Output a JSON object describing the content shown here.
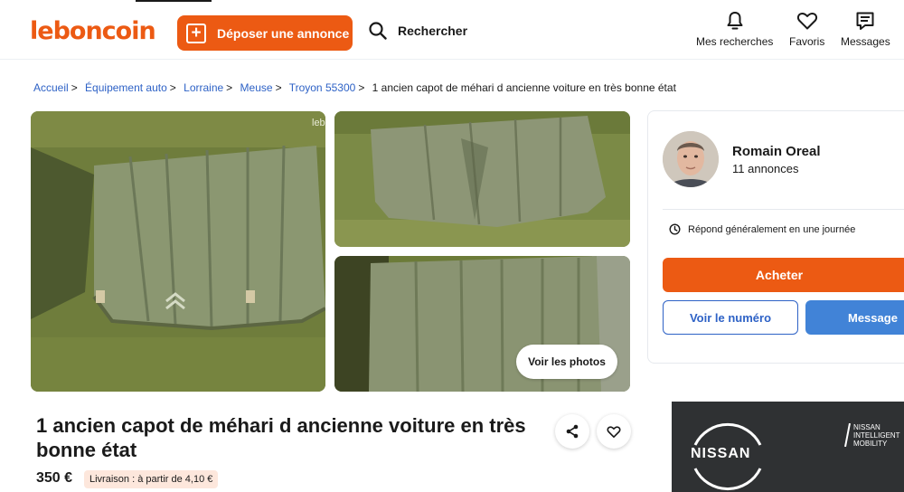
{
  "header": {
    "logo": "leboncoin",
    "post_ad_label": "Déposer une annonce",
    "search_label": "Rechercher",
    "nav": [
      {
        "label": "Mes recherches",
        "icon": "bell-icon"
      },
      {
        "label": "Favoris",
        "icon": "heart-icon"
      },
      {
        "label": "Messages",
        "icon": "message-icon"
      }
    ]
  },
  "breadcrumb": [
    {
      "label": "Accueil",
      "link": false
    },
    {
      "label": "Équipement auto",
      "link": true
    },
    {
      "label": "Lorraine",
      "link": true
    },
    {
      "label": "Meuse",
      "link": true
    },
    {
      "label": "Troyon 55300",
      "link": true
    },
    {
      "label": "1 ancien capot de méhari d ancienne voiture en très bonne état",
      "link": false
    }
  ],
  "gallery": {
    "view_photos_label": "Voir les photos",
    "watermark": "leb"
  },
  "listing": {
    "title": "1 ancien capot de méhari d ancienne voiture en très bonne état",
    "price": "350 €",
    "delivery": "Livraison : à partir de 4,10 €"
  },
  "seller": {
    "name": "Romain Oreal",
    "ads_count": "11 annonces",
    "response_time": "Répond généralement en une journée",
    "buy_label": "Acheter",
    "phone_label": "Voir le numéro",
    "message_label": "Message"
  },
  "ad": {
    "brand": "NISSAN",
    "tagline_1": "NISSAN",
    "tagline_2": "INTELLIGENT",
    "tagline_3": "MOBILITY"
  },
  "colors": {
    "brand_orange": "#ec5a13",
    "link_blue": "#2e62c6",
    "message_blue": "#4183d7"
  }
}
